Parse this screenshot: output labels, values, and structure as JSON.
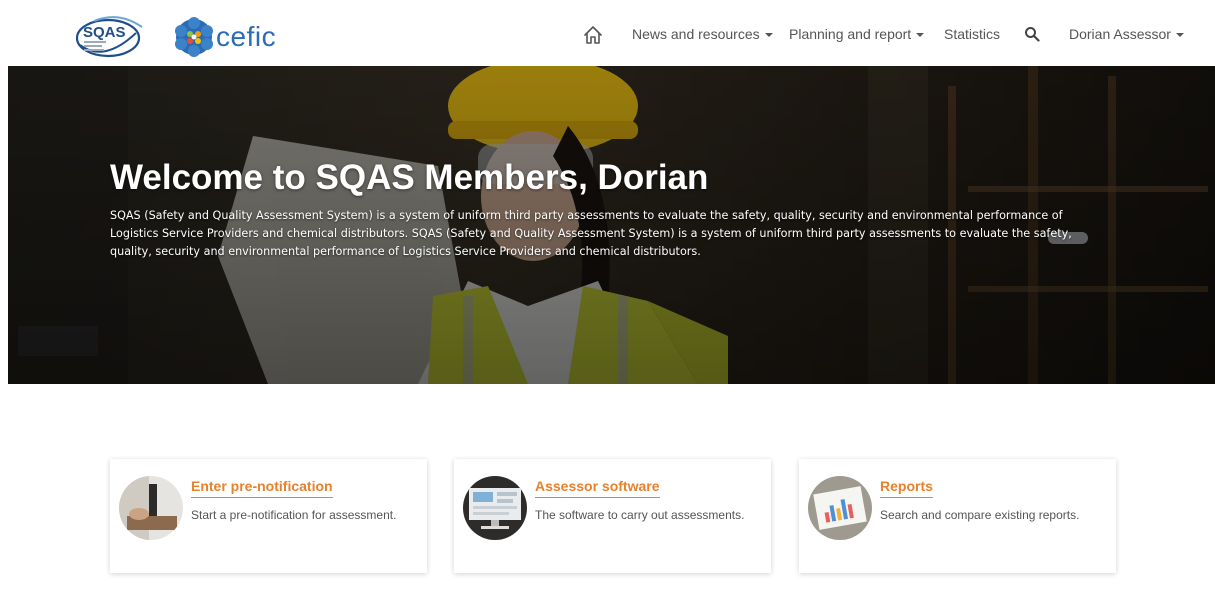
{
  "header": {
    "sqas_logo_text": "SQAS",
    "cefic_logo_text": "cefic",
    "nav": {
      "home_icon": "home-icon",
      "news": "News and resources",
      "planning": "Planning and report",
      "statistics": "Statistics",
      "search_icon": "search-icon",
      "user": "Dorian Assessor"
    }
  },
  "hero": {
    "title": "Welcome to SQAS Members, Dorian",
    "text": "SQAS (Safety and Quality Assessment System) is a system of uniform third party assessments to evaluate the safety, quality, security and environmental performance of Logistics Service Providers and chemical distributors. SQAS (Safety and Quality Assessment System) is a system of uniform third party assessments to evaluate the safety, quality, security and environmental performance of Logistics Service Providers and chemical distributors."
  },
  "cards": [
    {
      "title": "Enter pre-notification",
      "desc": "Start a pre-notification for assessment."
    },
    {
      "title": "Assessor software",
      "desc": "The software to carry out assessments."
    },
    {
      "title": "Reports",
      "desc": "Search and compare existing reports."
    }
  ],
  "colors": {
    "accent": "#e8812b",
    "brand_blue": "#2b6cb5",
    "nav_text": "#555555"
  }
}
